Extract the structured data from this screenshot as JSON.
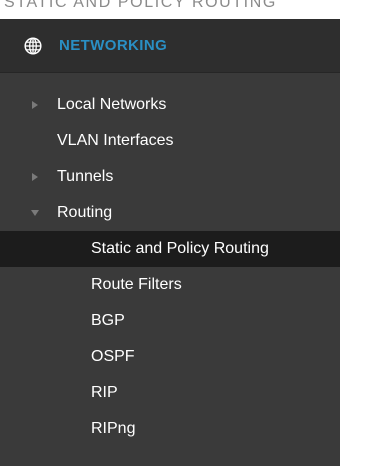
{
  "page_header": {
    "text": "Static and Policy Routing"
  },
  "nav": {
    "title": "NETWORKING",
    "icon": "globe-icon",
    "colors": {
      "panel_bg": "#3a3a3a",
      "header_bg": "#2e2e2e",
      "active_bg": "#1c1c1c",
      "accent": "#2a8fc4",
      "text": "#ffffff",
      "caret": "#7a7a7a"
    },
    "items": [
      {
        "label": "Local Networks",
        "caret": "right"
      },
      {
        "label": "VLAN Interfaces",
        "caret": "none"
      },
      {
        "label": "Tunnels",
        "caret": "right"
      },
      {
        "label": "Routing",
        "caret": "down"
      },
      {
        "label": "Static and Policy Routing",
        "active": true
      },
      {
        "label": "Route Filters"
      },
      {
        "label": "BGP"
      },
      {
        "label": "OSPF"
      },
      {
        "label": "RIP"
      },
      {
        "label": "RIPng"
      }
    ]
  }
}
